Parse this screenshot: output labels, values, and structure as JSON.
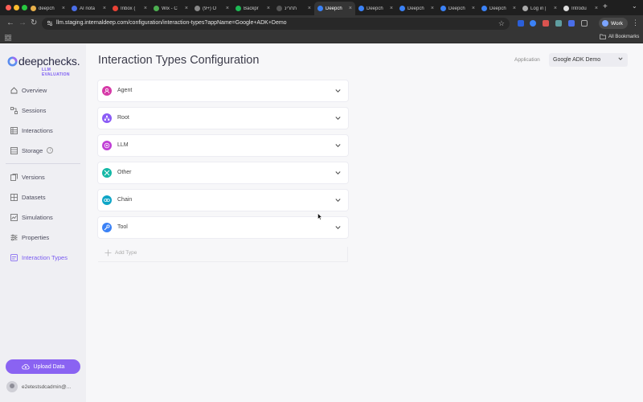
{
  "browser": {
    "tabs": [
      {
        "title": "deepch",
        "color": "#e8b04a"
      },
      {
        "title": "AI nota",
        "color": "#4a6ee8"
      },
      {
        "title": "Inbox (",
        "color": "#e94235"
      },
      {
        "title": "Wix - C",
        "color": "#4caf50"
      },
      {
        "title": "(9+) O",
        "color": "#888888"
      },
      {
        "title": "Backpr",
        "color": "#1db954"
      },
      {
        "title": "תחרינ",
        "color": "#555555"
      },
      {
        "title": "Deepch",
        "color": "#3b82f6",
        "active": true
      },
      {
        "title": "Deepch",
        "color": "#3b82f6"
      },
      {
        "title": "Deepch",
        "color": "#3b82f6"
      },
      {
        "title": "Deepch",
        "color": "#3b82f6"
      },
      {
        "title": "Deepch",
        "color": "#3b82f6"
      },
      {
        "title": "Log in |",
        "color": "#aaaaaa"
      },
      {
        "title": "Introdu",
        "color": "#dddddd"
      }
    ],
    "url": "llm.staging.internaldeep.com/configuration/interaction-types?appName=Google+ADK+Demo",
    "profile": "Work",
    "all_bookmarks": "All Bookmarks"
  },
  "sidebar": {
    "logo_word": "deepchecks.",
    "logo_sub": "LLM EVALUATION",
    "items": [
      {
        "label": "Overview",
        "icon": "home-icon"
      },
      {
        "label": "Sessions",
        "icon": "sessions-icon"
      },
      {
        "label": "Interactions",
        "icon": "interactions-icon"
      },
      {
        "label": "Storage",
        "icon": "storage-icon"
      },
      {
        "label": "Versions",
        "icon": "versions-icon"
      },
      {
        "label": "Datasets",
        "icon": "datasets-icon"
      },
      {
        "label": "Simulations",
        "icon": "simulations-icon"
      },
      {
        "label": "Properties",
        "icon": "properties-icon"
      },
      {
        "label": "Interaction Types",
        "icon": "interaction-types-icon",
        "active": true
      }
    ],
    "upload_label": "Upload Data",
    "user": "e2etestsdcadmin@..."
  },
  "main": {
    "title": "Interaction Types Configuration",
    "application_label": "Application",
    "application_value": "Google ADK Demo",
    "types": [
      {
        "label": "Agent",
        "color": "#d63aa8",
        "icon": "agent-icon"
      },
      {
        "label": "Root",
        "color": "#8b5cf6",
        "icon": "root-icon"
      },
      {
        "label": "LLM",
        "color": "#c03fd6",
        "icon": "llm-icon"
      },
      {
        "label": "Other",
        "color": "#14b8a6",
        "icon": "other-icon"
      },
      {
        "label": "Chain",
        "color": "#0ea5c6",
        "icon": "chain-icon"
      },
      {
        "label": "Tool",
        "color": "#3b82f6",
        "icon": "tool-icon"
      }
    ],
    "add_type_label": "Add Type"
  },
  "colors": {
    "accent": "#8a63f2",
    "active_nav": "#7a5cf0"
  }
}
